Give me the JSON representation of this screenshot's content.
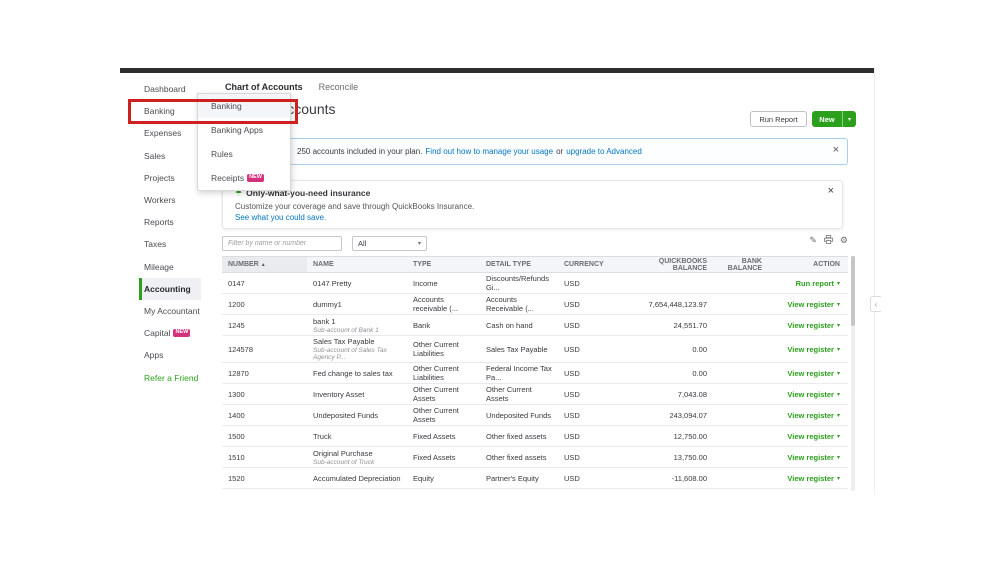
{
  "colors": {
    "accent_green": "#2ca01c",
    "link_blue": "#0077c5",
    "badge_pink": "#d4317c",
    "annotation_red": "#cf2020"
  },
  "tabs": {
    "items": [
      {
        "label": "Chart of Accounts"
      },
      {
        "label": "Reconcile"
      }
    ]
  },
  "sidebar": {
    "items": [
      {
        "label": "Dashboard"
      },
      {
        "label": "Banking"
      },
      {
        "label": "Expenses"
      },
      {
        "label": "Sales"
      },
      {
        "label": "Projects"
      },
      {
        "label": "Workers"
      },
      {
        "label": "Reports"
      },
      {
        "label": "Taxes"
      },
      {
        "label": "Mileage"
      },
      {
        "label": "Accounting",
        "flags": [
          "active"
        ]
      },
      {
        "label": "My Accountant"
      },
      {
        "label": "Capital",
        "badge": "NEW"
      },
      {
        "label": "Apps"
      },
      {
        "label": "Refer a Friend",
        "flags": [
          "link"
        ]
      }
    ]
  },
  "banking_menu": {
    "items": [
      {
        "label": "Banking",
        "flags": [
          "selected"
        ]
      },
      {
        "label": "Banking Apps"
      },
      {
        "label": "Rules"
      },
      {
        "label": "Receipts",
        "badge": "NEW"
      }
    ]
  },
  "header": {
    "title": "Chart of Accounts",
    "run_report_label": "Run Report",
    "new_label": "New"
  },
  "plan_banner": {
    "text": "250 accounts included in your plan.",
    "link_usage": "Find out how to manage your usage",
    "conjunction": "or",
    "link_upgrade": "upgrade to Advanced"
  },
  "insurance_card": {
    "title": "Only-what-you-need insurance",
    "body": "Customize your coverage and save through QuickBooks Insurance.",
    "link": "See what you could save."
  },
  "filter_bar": {
    "placeholder": "Filter by name or number",
    "scope_value": "All"
  },
  "table": {
    "columns": [
      "NUMBER",
      "NAME",
      "TYPE",
      "DETAIL TYPE",
      "CURRENCY",
      "QUICKBOOKS BALANCE",
      "BANK BALANCE",
      "ACTION"
    ],
    "sort": {
      "column": "NUMBER",
      "direction": "asc"
    },
    "rows": [
      {
        "number": "0147",
        "name": "0147 Pretty",
        "type": "Income",
        "detail": "Discounts/Refunds Gi...",
        "currency": "USD",
        "qb_balance": "",
        "bank_balance": "",
        "action": "Run report"
      },
      {
        "number": "1200",
        "name": "dummy1",
        "type": "Accounts receivable (...",
        "detail": "Accounts Receivable (...",
        "currency": "USD",
        "qb_balance": "7,654,448,123.97",
        "bank_balance": "",
        "action": "View register"
      },
      {
        "number": "1245",
        "name": "bank 1",
        "sub": "Sub-account of Bank 1",
        "type": "Bank",
        "detail": "Cash on hand",
        "currency": "USD",
        "qb_balance": "24,551.70",
        "bank_balance": "",
        "action": "View register"
      },
      {
        "number": "124578",
        "name": "Sales Tax Payable",
        "sub": "Sub-account of Sales Tax Agency P...",
        "type": "Other Current Liabilities",
        "detail": "Sales Tax Payable",
        "currency": "USD",
        "qb_balance": "0.00",
        "bank_balance": "",
        "action": "View register"
      },
      {
        "number": "12870",
        "name": "Fed change to sales tax",
        "type": "Other Current Liabilities",
        "detail": "Federal Income Tax Pa...",
        "currency": "USD",
        "qb_balance": "0.00",
        "bank_balance": "",
        "action": "View register"
      },
      {
        "number": "1300",
        "name": "Inventory Asset",
        "type": "Other Current Assets",
        "detail": "Other Current Assets",
        "currency": "USD",
        "qb_balance": "7,043.08",
        "bank_balance": "",
        "action": "View register"
      },
      {
        "number": "1400",
        "name": "Undeposited Funds",
        "type": "Other Current Assets",
        "detail": "Undeposited Funds",
        "currency": "USD",
        "qb_balance": "243,094.07",
        "bank_balance": "",
        "action": "View register"
      },
      {
        "number": "1500",
        "name": "Truck",
        "type": "Fixed Assets",
        "detail": "Other fixed assets",
        "currency": "USD",
        "qb_balance": "12,750.00",
        "bank_balance": "",
        "action": "View register"
      },
      {
        "number": "1510",
        "name": "Original Purchase",
        "sub": "Sub-account of Truck",
        "type": "Fixed Assets",
        "detail": "Other fixed assets",
        "currency": "USD",
        "qb_balance": "13,750.00",
        "bank_balance": "",
        "action": "View register"
      },
      {
        "number": "1520",
        "name": "Accumulated Depreciation",
        "type": "Equity",
        "detail": "Partner's Equity",
        "currency": "USD",
        "qb_balance": "-11,608.00",
        "bank_balance": "",
        "action": "View register"
      }
    ]
  }
}
